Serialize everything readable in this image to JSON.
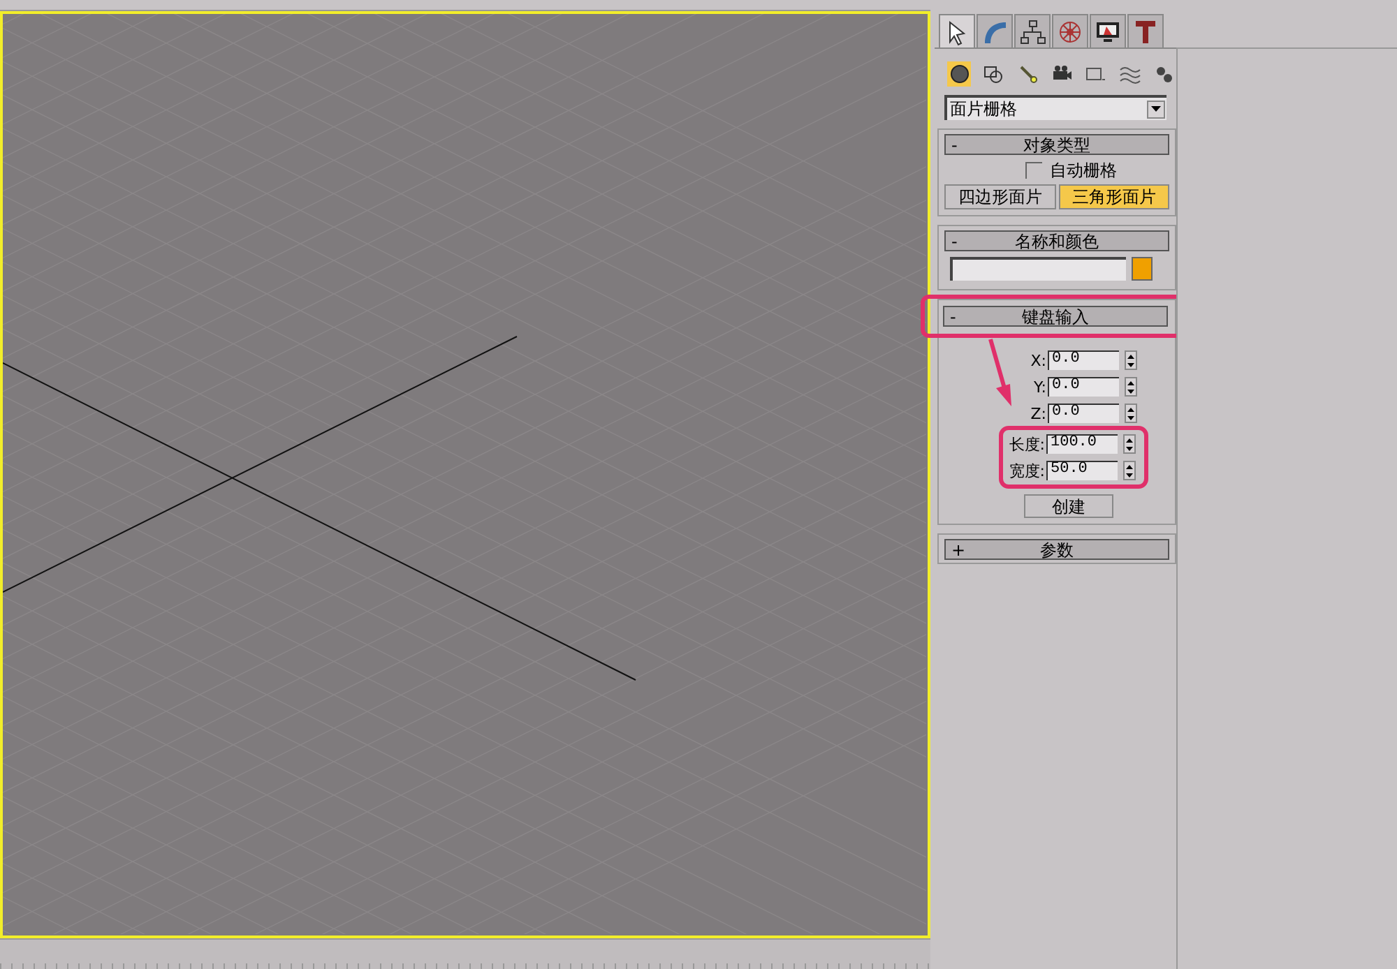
{
  "command_tabs": [
    {
      "selected": true
    },
    {
      "selected": false
    },
    {
      "selected": false
    },
    {
      "selected": false
    },
    {
      "selected": false
    },
    {
      "selected": false
    }
  ],
  "categories": [
    {
      "selected": true
    },
    {
      "selected": false
    },
    {
      "selected": false
    },
    {
      "selected": false
    },
    {
      "selected": false
    },
    {
      "selected": false
    },
    {
      "selected": false
    }
  ],
  "dropdown": {
    "value": "面片栅格"
  },
  "rollouts": [
    {
      "kind": "object_type",
      "toggle": "-",
      "title": "对象类型",
      "checkbox": {
        "label": "自动栅格",
        "checked": false
      },
      "buttons": [
        {
          "label": "四边形面片",
          "selected": false
        },
        {
          "label": "三角形面片",
          "selected": true
        }
      ]
    },
    {
      "kind": "name_color",
      "toggle": "-",
      "title": "名称和颜色",
      "color": "#f0a000"
    },
    {
      "kind": "keyboard",
      "toggle": "-",
      "title": "键盘输入",
      "highlighted": true,
      "field_groups": [
        {
          "highlighted": false,
          "fields": [
            {
              "label": "X:",
              "value": "0.0"
            },
            {
              "label": "Y:",
              "value": "0.0"
            },
            {
              "label": "Z:",
              "value": "0.0"
            }
          ]
        },
        {
          "highlighted": true,
          "fields": [
            {
              "label": "长度:",
              "value": "100.0"
            },
            {
              "label": "宽度:",
              "value": "50.0"
            }
          ]
        }
      ],
      "button": "创建"
    },
    {
      "kind": "collapsed",
      "toggle": "+",
      "title": "参数"
    }
  ]
}
